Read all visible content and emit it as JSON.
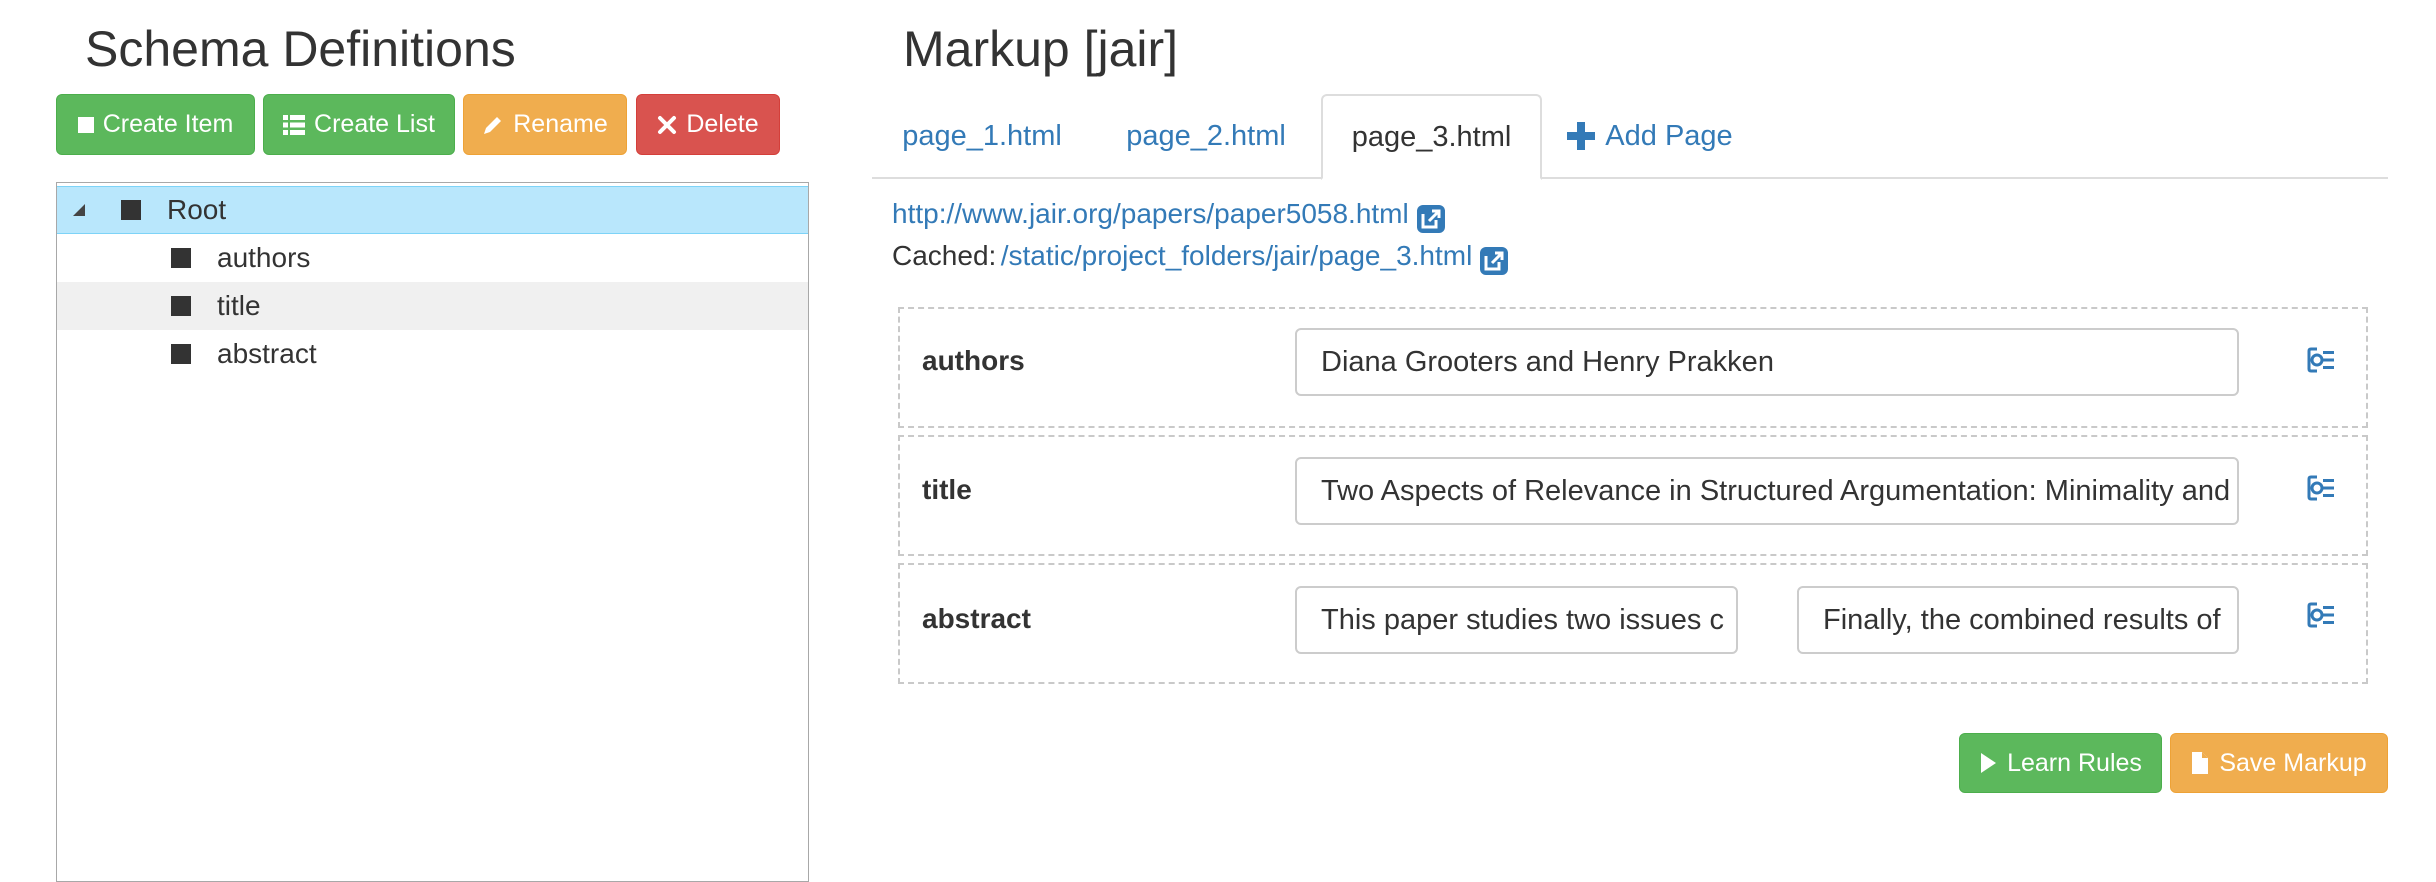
{
  "schema": {
    "title": "Schema Definitions",
    "buttons": {
      "create_item": "Create Item",
      "create_list": "Create List",
      "rename": "Rename",
      "delete": "Delete"
    },
    "tree": {
      "root": "Root",
      "children": [
        "authors",
        "title",
        "abstract"
      ]
    }
  },
  "markup": {
    "title": "Markup [jair]",
    "tabs": [
      "page_1.html",
      "page_2.html",
      "page_3.html"
    ],
    "add_page": "Add Page",
    "active_tab": "page_3.html",
    "url": "http://www.jair.org/papers/paper5058.html",
    "cached_label": "Cached:",
    "cached_url": "/static/project_folders/jair/page_3.html",
    "fields": [
      {
        "label": "authors",
        "values": [
          "Diana Grooters and Henry Prakken"
        ]
      },
      {
        "label": "title",
        "values": [
          "Two Aspects of Relevance in Structured Argumentation: Minimality and"
        ]
      },
      {
        "label": "abstract",
        "values": [
          "This paper studies two issues c",
          "Finally, the combined results of"
        ]
      }
    ],
    "actions": {
      "learn_rules": "Learn Rules",
      "save_markup": "Save Markup"
    }
  },
  "colors": {
    "green": "#5cb85c",
    "orange": "#f0ad4e",
    "red": "#d9534f",
    "link": "#337ab7",
    "selection": "#b9e7fc"
  },
  "icons": [
    "stop-icon",
    "list-icon",
    "pencil-icon",
    "times-icon",
    "plus-icon",
    "external-link-icon",
    "target-icon",
    "play-icon",
    "file-icon"
  ]
}
